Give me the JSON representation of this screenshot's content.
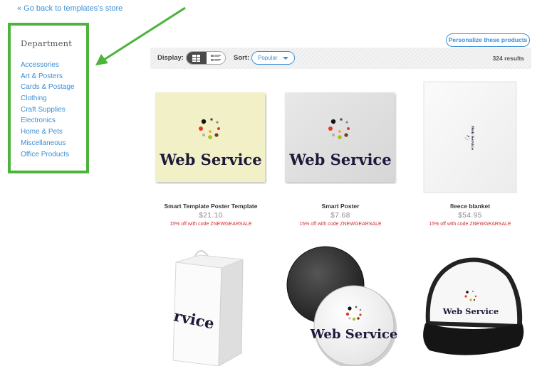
{
  "nav": {
    "back_link": "« Go back to templates's store"
  },
  "sidebar": {
    "title": "Department",
    "items": [
      {
        "label": "Accessories"
      },
      {
        "label": "Art & Posters"
      },
      {
        "label": "Cards & Postage"
      },
      {
        "label": "Clothing"
      },
      {
        "label": "Craft Supplies"
      },
      {
        "label": "Electronics"
      },
      {
        "label": "Home & Pets"
      },
      {
        "label": "Miscellaneous"
      },
      {
        "label": "Office Products"
      }
    ]
  },
  "toolbar": {
    "personalize_label": "Personalize these products",
    "display_label": "Display:",
    "sort_label": "Sort:",
    "sort_value": "Popular",
    "results": "324 results"
  },
  "products": [
    {
      "name": "Smart Template Poster Template",
      "price": "$21.10",
      "promo": "15% off with code ZNEWGEARSALE",
      "logo_text": "Web Service"
    },
    {
      "name": "Smart Poster",
      "price": "$7.68",
      "promo": "15% off with code ZNEWGEARSALE",
      "logo_text": "Web Service"
    },
    {
      "name": "fleece blanket",
      "price": "$54.95",
      "promo": "15% off with code ZNEWGEARSALE",
      "logo_text": "Web Service"
    },
    {
      "logo_text": "rvice"
    },
    {
      "logo_text": "Web Service"
    },
    {
      "logo_text": "Web Service"
    }
  ],
  "colors": {
    "link": "#3b8fd6",
    "highlight": "#4cb43a",
    "promo": "#d42a2a",
    "logo_text": "#1b1a3a"
  }
}
